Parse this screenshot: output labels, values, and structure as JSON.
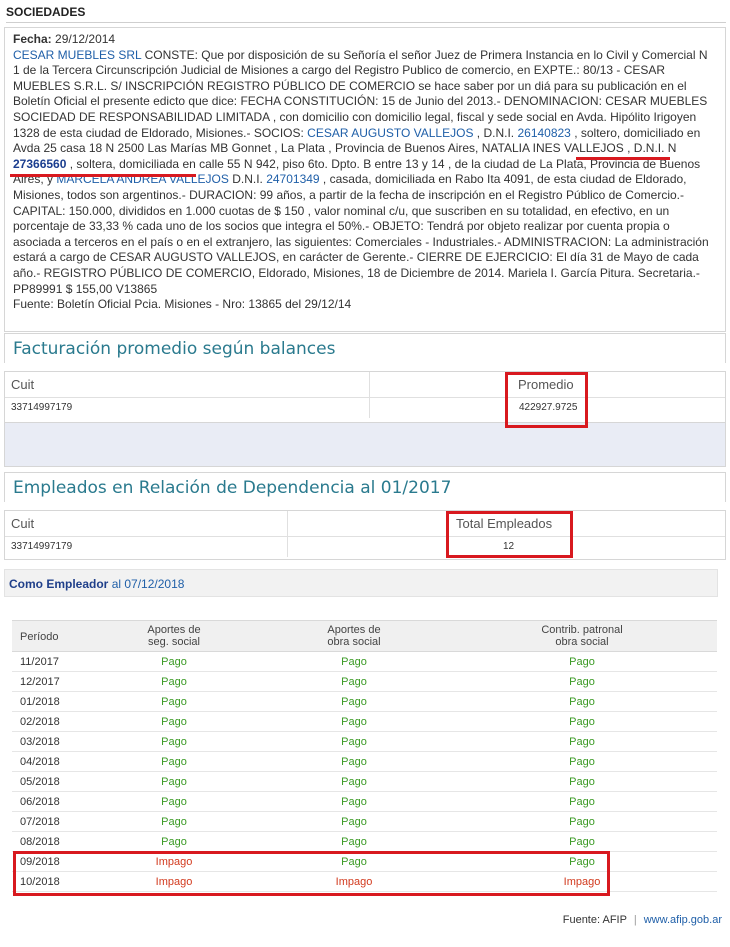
{
  "section_title": "SOCIEDADES",
  "edicto": {
    "fecha_label": "Fecha:",
    "fecha": "29/12/2014",
    "company_link": "CESAR MUEBLES SRL",
    "p1": " CONSTE: Que por disposición de su Señoría el señor Juez de Primera Instancia en lo Civil y Comercial N 1 de la Tercera Circunscripción Judicial de Misiones a cargo del Registro Publico de comercio, en EXPTE.: 80/13 - CESAR MUEBLES S.R.L. S/ INSCRIPCIÓN REGISTRO PÚBLICO DE COMERCIO se hace saber por un diá para su publicación en el Boletín Oficial el presente edicto que dice: FECHA CONSTITUCIÓN: 15 de Junio del 2013.- DENOMINACION: CESAR MUEBLES SOCIEDAD DE RESPONSABILIDAD LIMITADA , con domicilio con domicilio legal, fiscal y sede social en Avda. Hipólito Irigoyen 1328 de esta ciudad de Eldorado, Misiones.- SOCIOS: ",
    "socio1": "CESAR AUGUSTO VALLEJOS",
    "p2": " , D.N.I. ",
    "dni1": "26140823",
    "p3": " , soltero, domiciliado en Avda 25 casa 18 N 2500 Las Marías MB Gonnet , La Plata , Provincia de Buenos Aires, ",
    "socio2": "NATALIA INES VALLEJOS",
    "p4": " , D.N.I. N ",
    "dni2": "27366560",
    "p5": " , soltera, domiciliada en calle 55 N 942, piso 6to. Dpto. B entre 13 y 14 , de la ciudad de La Plata, Provincia de Buenos Aires, y ",
    "socio3": "MARCELA ANDREA VALLEJOS",
    "p6": " D.N.I. ",
    "dni3": "24701349",
    "p7": " , casada, domiciliada en Rabo Ita 4091, de esta ciudad de Eldorado, Misiones, todos son argentinos.- DURACION: 99 años, a partir de la fecha de inscripción en el Registro Público de Comercio.- CAPITAL: 150.000, divididos en 1.000 cuotas de $ 150 , valor nominal c/u, que suscriben en su totalidad, en efectivo, en un porcentaje de 33,33 % cada uno de los socios que integra el 50%.- OBJETO: Tendrá por objeto realizar por cuenta propia o asociada a terceros en el país o en el extranjero, las siguientes: Comerciales - Industriales.- ADMINISTRACION: La administración estará a cargo de CESAR AUGUSTO VALLEJOS, en carácter de Gerente.- CIERRE DE EJERCICIO: El día 31 de Mayo de cada año.- REGISTRO PÚBLICO DE COMERCIO, Eldorado, Misiones, 18 de Diciembre de 2014. Mariela I. García Pitura. Secretaria.- PP89991 $ 155,00 V13865",
    "fuente": "Fuente: Boletín Oficial Pcia. Misiones - Nro: 13865 del 29/12/14"
  },
  "facturacion": {
    "title": "Facturación promedio según balances",
    "col_cuit": "Cuit",
    "col_promedio": "Promedio",
    "cuit": "33714997179",
    "promedio": "422927.9725"
  },
  "empleados": {
    "title": "Empleados en Relación de Dependencia al 01/2017",
    "col_cuit": "Cuit",
    "col_total": "Total Empleados",
    "cuit": "33714997179",
    "total": "12"
  },
  "empleador": {
    "label": "Como Empleador",
    "date_text": " al 07/12/2018"
  },
  "pagos": {
    "headers": {
      "periodo": "Período",
      "seg_l1": "Aportes de",
      "seg_l2": "seg. social",
      "obra_l1": "Aportes de",
      "obra_l2": "obra social",
      "contrib_l1": "Contrib. patronal",
      "contrib_l2": "obra social"
    },
    "rows": [
      {
        "periodo": "11/2017",
        "seg": "Pago",
        "obra": "Pago",
        "contrib": "Pago"
      },
      {
        "periodo": "12/2017",
        "seg": "Pago",
        "obra": "Pago",
        "contrib": "Pago"
      },
      {
        "periodo": "01/2018",
        "seg": "Pago",
        "obra": "Pago",
        "contrib": "Pago"
      },
      {
        "periodo": "02/2018",
        "seg": "Pago",
        "obra": "Pago",
        "contrib": "Pago"
      },
      {
        "periodo": "03/2018",
        "seg": "Pago",
        "obra": "Pago",
        "contrib": "Pago"
      },
      {
        "periodo": "04/2018",
        "seg": "Pago",
        "obra": "Pago",
        "contrib": "Pago"
      },
      {
        "periodo": "05/2018",
        "seg": "Pago",
        "obra": "Pago",
        "contrib": "Pago"
      },
      {
        "periodo": "06/2018",
        "seg": "Pago",
        "obra": "Pago",
        "contrib": "Pago"
      },
      {
        "periodo": "07/2018",
        "seg": "Pago",
        "obra": "Pago",
        "contrib": "Pago"
      },
      {
        "periodo": "08/2018",
        "seg": "Pago",
        "obra": "Pago",
        "contrib": "Pago"
      },
      {
        "periodo": "09/2018",
        "seg": "Impago",
        "obra": "Pago",
        "contrib": "Pago"
      },
      {
        "periodo": "10/2018",
        "seg": "Impago",
        "obra": "Impago",
        "contrib": "Impago"
      }
    ]
  },
  "footer": {
    "fuente": "Fuente: AFIP",
    "sep": "|",
    "link": "www.afip.gob.ar"
  },
  "colors": {
    "pago": "#3a9a24",
    "impago": "#d23a1e",
    "highlight": "#d8191f",
    "link": "#1f5fa8"
  }
}
